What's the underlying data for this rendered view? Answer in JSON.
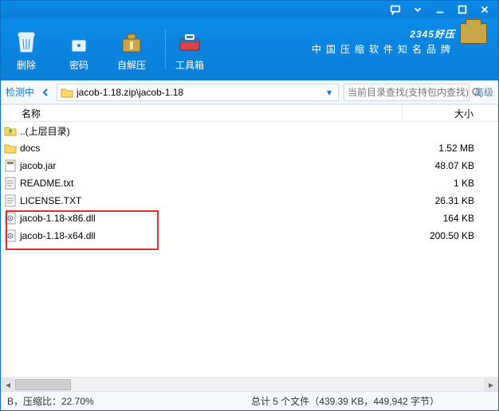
{
  "titlebar": {},
  "toolbar": {
    "delete": "删除",
    "password": "密码",
    "selfextract": "自解压",
    "toolbox": "工具箱"
  },
  "brand": {
    "name": "2345好压",
    "slogan": "中国压缩软件知名品牌"
  },
  "pathbar": {
    "status": "检测中",
    "path": "jacob-1.18.zip\\jacob-1.18",
    "search_placeholder": "当前目录查找(支持包内查找)",
    "advanced": "高级"
  },
  "columns": {
    "name": "名称",
    "size": "大小"
  },
  "files": [
    {
      "icon": "up",
      "name": "..(上层目录)",
      "size": ""
    },
    {
      "icon": "folder",
      "name": "docs",
      "size": "1.52 MB"
    },
    {
      "icon": "jar",
      "name": "jacob.jar",
      "size": "48.07 KB"
    },
    {
      "icon": "txt",
      "name": "README.txt",
      "size": "1 KB"
    },
    {
      "icon": "txt",
      "name": "LICENSE.TXT",
      "size": "26.31 KB"
    },
    {
      "icon": "dll",
      "name": "jacob-1.18-x86.dll",
      "size": "164 KB"
    },
    {
      "icon": "dll",
      "name": "jacob-1.18-x64.dll",
      "size": "200.50 KB"
    }
  ],
  "statusbar": {
    "left": "B，压缩比：22.70%",
    "mid": "总计 5 个文件（439.39 KB，449,942 字节）"
  }
}
